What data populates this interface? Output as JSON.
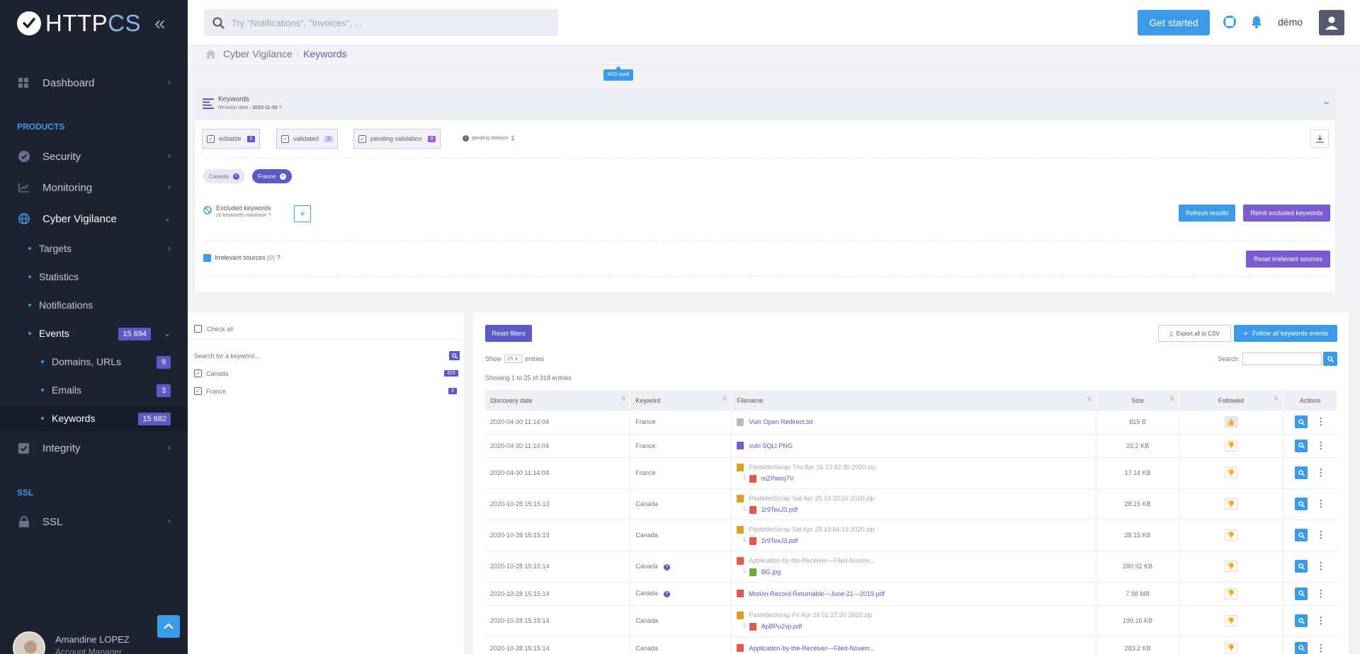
{
  "app": {
    "logo_http": "HTTP",
    "logo_cs": "CS"
  },
  "colors": {
    "sidebar": "#1f2231",
    "accent": "#3c9be8",
    "primary": "#5b5ac8",
    "section": "#3c9be8"
  },
  "sidebar": {
    "collapse_icon": "double-chevron-left-icon",
    "dashboard": "Dashboard",
    "section_products": "PRODUCTS",
    "security": "Security",
    "monitoring": "Monitoring",
    "cyber": "Cyber Vigilance",
    "targets": "Targets",
    "statistics": "Statistics",
    "notifications": "Notifications",
    "events": "Events",
    "events_count": "15 694",
    "domains": "Domains, URLs",
    "domains_count": "9",
    "emails": "Emails",
    "emails_count": "3",
    "keywords": "Keywords",
    "keywords_count": "15 682",
    "integrity": "Integrity",
    "section_ssl": "SSL",
    "ssl": "SSL",
    "user_name": "Amandine LOPEZ",
    "user_role": "Account Manager"
  },
  "topbar": {
    "search_placeholder": "Try \"Notifications\", \"Invoices\", ...",
    "get_started": "Get started",
    "user": "démo"
  },
  "breadcrumb": {
    "parent": "Cyber Vigilance",
    "current": "Keywords"
  },
  "usage": "4/10 used",
  "keywords_panel": {
    "title": "Keywords",
    "revision_label": "Revision date :",
    "revision_date": "2020-11-30",
    "filters": [
      {
        "label": "editable",
        "count": "2"
      },
      {
        "label": "validated",
        "count": "3"
      },
      {
        "label": "pending validation",
        "count": "0"
      }
    ],
    "pending_deletion": "pending deletion",
    "pending_deletion_count": "1",
    "tags": [
      "Canada",
      "France"
    ],
    "excluded_title": "Excluded keywords",
    "excluded_sub": "20 keywords maximum",
    "refresh": "Refresh results",
    "reinit": "Reinit excluded keywords",
    "irrelevant": "Irrelevant sources",
    "irrelevant_count": "(0)",
    "reset_irrelevant": "Reset irrelevant sources"
  },
  "left_filter": {
    "check_all": "Check all",
    "search_placeholder": "Search for a keyword...",
    "items": [
      {
        "label": "Canada",
        "count": "315"
      },
      {
        "label": "France",
        "count": "3"
      }
    ]
  },
  "events_table": {
    "reset_filters": "Reset filters",
    "export": "Export all to CSV",
    "follow": "Follow all keywords events",
    "show": "Show",
    "page_size": "25",
    "entries": "entries",
    "search_label": "Search:",
    "showing": "Showing 1 to 25 of 318 entries",
    "columns": [
      "Discovery date",
      "Keyword",
      "Filename",
      "Size",
      "Followed",
      "Actions"
    ],
    "rows": [
      {
        "date": "2020-04-30 11:14:04",
        "keyword": "France",
        "file": "Vuln Open Redirect.txt",
        "child": "",
        "size": "815 B",
        "followed": true
      },
      {
        "date": "2020-04-30 11:14:04",
        "keyword": "France",
        "file": "vuln SQLI.PNG",
        "child": "",
        "size": "25.2 KB",
        "followed": false
      },
      {
        "date": "2020-04-30 11:14:04",
        "keyword": "France",
        "file": "PastebinScrap Thu Apr 16 13:42:30 2020.zip",
        "child": "mZPwmj7V",
        "size": "17.14 KB",
        "followed": false
      },
      {
        "date": "2020-10-28 15:15:13",
        "keyword": "Canada",
        "file": "PastebinScrap Sat Apr 25 19:32:10 2020.zip",
        "child": "2r9TexJ3.pdf",
        "size": "28.15 KB",
        "followed": false
      },
      {
        "date": "2020-10-28 15:15:13",
        "keyword": "Canada",
        "file": "PastebinScrap Sat Apr 25 19:54:19 2020.zip",
        "child": "2r9TexJ3.pdf",
        "size": "28.15 KB",
        "followed": false
      },
      {
        "date": "2020-10-28 15:15:14",
        "keyword": "Canada",
        "file": "Application-by-the-Receiver---Filed-Novem...",
        "child": "BG.jpg",
        "size": "280.92 KB",
        "followed": false
      },
      {
        "date": "2020-10-28 15:15:14",
        "keyword": "Canada",
        "file": "Motion-Record-Returnable---June-21---2019.pdf",
        "child": "",
        "size": "7.98 MB",
        "followed": false
      },
      {
        "date": "2020-10-28 15:15:14",
        "keyword": "Canada",
        "file": "PastebinScrap Fri Apr 24 01:27:20 2020.zip",
        "child": "ApBPu2vp.pdf",
        "size": "199.16 KB",
        "followed": false
      },
      {
        "date": "2020-10-28 15:15:14",
        "keyword": "Canada",
        "file": "Application-by-the-Receiver---Filed-Novem...",
        "child": "",
        "size": "283.2 KB",
        "followed": false
      }
    ]
  }
}
